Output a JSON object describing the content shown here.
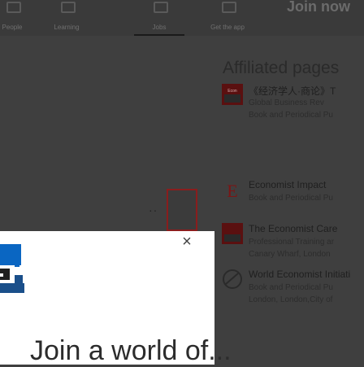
{
  "nav": {
    "items": [
      {
        "label": "People"
      },
      {
        "label": "Learning"
      },
      {
        "label": "Jobs"
      },
      {
        "label": "Get the app"
      }
    ],
    "join_label": "Join now"
  },
  "affiliated": {
    "title": "Affiliated pages",
    "companies": [
      {
        "name": "《经济学人·商论》T",
        "desc": "Global Business Rev",
        "desc2": "Book and Periodical Pu"
      },
      {
        "name": "Economist Impact",
        "desc": "Book and Periodical Pu",
        "desc2": ""
      },
      {
        "name": "The Economist Care",
        "desc": "Professional Training ar",
        "desc2": "Canary Wharf, London"
      },
      {
        "name": "World Economist Initiati",
        "desc": "Book and Periodical Pu",
        "desc2": "London, London,City of"
      }
    ]
  },
  "modal": {
    "close_symbol": "×",
    "partial_heading": "Join a world of..."
  },
  "colors": {
    "overlay": "#3f3f3f",
    "accent": "#8a1d1d",
    "modal_bg": "#ffffff"
  }
}
